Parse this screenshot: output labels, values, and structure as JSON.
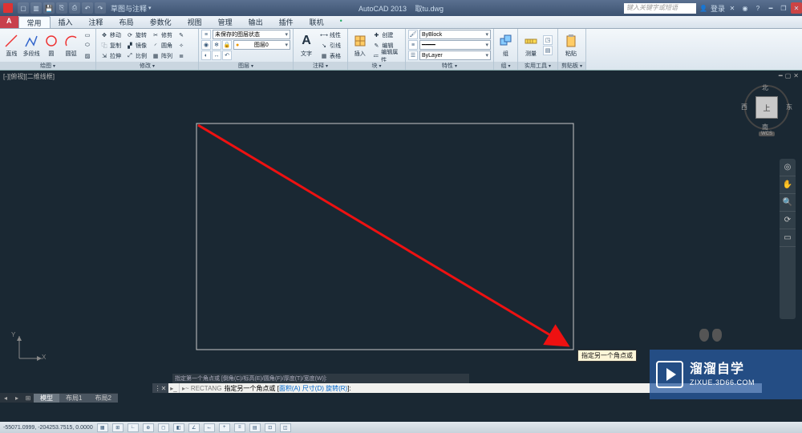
{
  "titlebar": {
    "workspace": "草图与注释",
    "app": "AutoCAD 2013",
    "file": "取tu.dwg",
    "search_placeholder": "键入关键字或短语",
    "login": "登录"
  },
  "tabs": {
    "big": "A",
    "items": [
      "常用",
      "插入",
      "注释",
      "布局",
      "参数化",
      "视图",
      "管理",
      "输出",
      "插件",
      "联机"
    ],
    "active": 0,
    "bullet": "•"
  },
  "ribbon": {
    "draw": {
      "title": "绘图",
      "line": "直线",
      "pline": "多段线",
      "circle": "圆",
      "arc": "圆弧"
    },
    "modify": {
      "title": "修改",
      "move": "移动",
      "rotate": "旋转",
      "trim": "修剪",
      "copy": "复制",
      "mirror": "镜像",
      "fillet": "圆角",
      "stretch": "拉伸",
      "scale": "比例",
      "array": "阵列"
    },
    "layers": {
      "title": "图层",
      "unsaved": "未保存的图层状态",
      "layer0": "图层0"
    },
    "annot": {
      "title": "注释",
      "text": "文字",
      "linear": "线性",
      "leader": "引线",
      "table": "表格"
    },
    "block": {
      "title": "块",
      "insert": "插入",
      "create": "创建",
      "edit": "编辑",
      "editattr": "编辑属性"
    },
    "props": {
      "title": "特性",
      "byblock": "ByBlock",
      "bylayer": "ByLayer",
      "match": "匹配"
    },
    "groups": {
      "title": "组",
      "group": "组"
    },
    "utils": {
      "title": "实用工具",
      "measure": "测量"
    },
    "clip": {
      "title": "剪贴板",
      "paste": "粘贴"
    }
  },
  "dwg": {
    "viewtitle": "[-][俯视][二维线框]",
    "cube": {
      "top": "上",
      "n": "北",
      "s": "南",
      "e": "东",
      "w": "西",
      "wcs": "WCS"
    },
    "tooltip": "指定另一个角点或",
    "ucs_x": "X",
    "ucs_y": "Y"
  },
  "cmd": {
    "history": "指定第一个角点或 [倒角(C)/标高(E)/圆角(F)/厚度(T)/宽度(W)]:",
    "prefix": "▸~ RECTANG ",
    "prompt": "指定另一个角点或 [",
    "opts": "面积(A) 尺寸(D) 旋转(R)",
    "suffix": "]:"
  },
  "mtabs": {
    "model": "模型",
    "l1": "布局1",
    "l2": "布局2"
  },
  "status": {
    "coords": "-55071.0999, -204253.7515, 0.0000"
  },
  "watermark": {
    "cn": "溜溜自学",
    "en": "ZIXUE.3D66.COM"
  }
}
